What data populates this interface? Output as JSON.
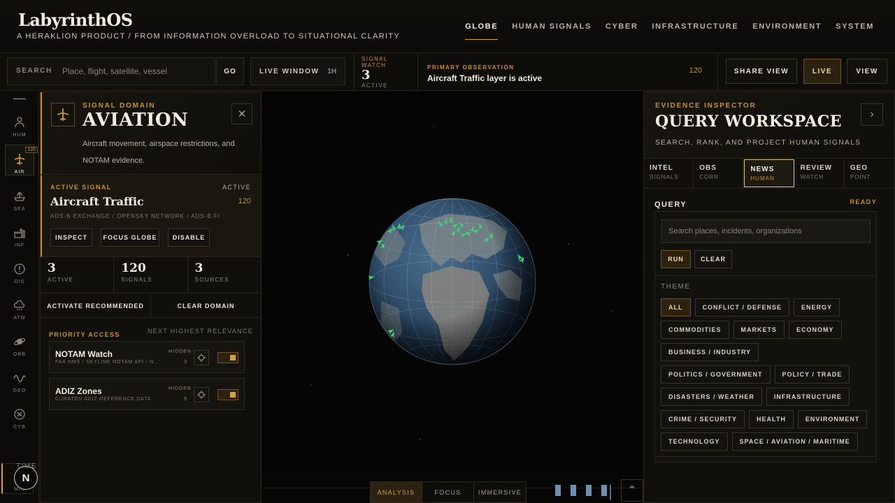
{
  "header": {
    "logo": "LabyrinthOS",
    "tagline": "A HERAKLION PRODUCT / FROM INFORMATION OVERLOAD TO SITUATIONAL CLARITY",
    "nav": [
      "GLOBE",
      "HUMAN SIGNALS",
      "CYBER",
      "INFRASTRUCTURE",
      "ENVIRONMENT",
      "SYSTEM"
    ],
    "active_nav": "GLOBE"
  },
  "toolbar": {
    "search_label": "SEARCH",
    "search_placeholder": "Place, flight, satellite, vessel",
    "go_label": "GO",
    "live_window_label": "LIVE WINDOW",
    "live_window_value": "1H",
    "signal_watch_label": "SIGNAL WATCH",
    "signal_watch_count": "3",
    "signal_watch_sub": "ACTIVE",
    "primary_obs_label": "PRIMARY OBSERVATION",
    "primary_obs_text": "Aircraft Traffic layer is active",
    "primary_obs_count": "120",
    "share_view_label": "SHARE VIEW",
    "live_label": "LIVE",
    "view_label": "VIEW"
  },
  "rail": {
    "items": [
      {
        "label": "HUM",
        "icon": "person-icon"
      },
      {
        "label": "AIR",
        "icon": "plane-icon",
        "badge": "120"
      },
      {
        "label": "SEA",
        "icon": "ship-icon"
      },
      {
        "label": "INF",
        "icon": "factory-icon"
      },
      {
        "label": "DIS",
        "icon": "alert-icon"
      },
      {
        "label": "ATM",
        "icon": "cloud-icon"
      },
      {
        "label": "ORB",
        "icon": "satellite-icon"
      },
      {
        "label": "GEO",
        "icon": "wave-icon"
      },
      {
        "label": "CYB",
        "icon": "cyber-icon"
      }
    ],
    "avatar_letter": "N",
    "min_label": "MIN"
  },
  "domain": {
    "kicker": "SIGNAL DOMAIN",
    "title": "AVIATION",
    "description": "Aircraft movement, airspace restrictions, and NOTAM evidence.",
    "active_signal": {
      "kicker": "ACTIVE SIGNAL",
      "state": "ACTIVE",
      "name": "Aircraft Traffic",
      "count": "120",
      "sources": "ADS-B EXCHANGE / OPENSKY NETWORK / ADS-B.FI",
      "inspect_label": "INSPECT",
      "focus_label": "FOCUS GLOBE",
      "disable_label": "DISABLE"
    },
    "stats": [
      {
        "value": "3",
        "label": "ACTIVE"
      },
      {
        "value": "120",
        "label": "SIGNALS"
      },
      {
        "value": "3",
        "label": "SOURCES"
      }
    ],
    "activate_label": "ACTIVATE RECOMMENDED",
    "clear_label": "CLEAR DOMAIN",
    "priority_label": "PRIORITY ACCESS",
    "priority_sub": "NEXT HIGHEST RELEVANCE",
    "priority_items": [
      {
        "name": "NOTAM Watch",
        "source": "FAA NMS / SKYLINK NOTAM API / N…",
        "state": "HIDDEN",
        "count": "3"
      },
      {
        "name": "ADIZ Zones",
        "source": "CURATED ADIZ REFERENCE DATA",
        "state": "HIDDEN",
        "count": "5"
      }
    ]
  },
  "globe": {
    "ocean_color": "#2c4a66",
    "land_color": "#7d8588",
    "aircraft_color": "#3fd07a"
  },
  "modes": [
    "ANALYSIS",
    "FOCUS",
    "IMMERSIVE"
  ],
  "active_mode": "ANALYSIS",
  "inspector": {
    "kicker": "EVIDENCE INSPECTOR",
    "title": "QUERY WORKSPACE",
    "subtitle": "SEARCH, RANK, AND PROJECT HUMAN SIGNALS",
    "tabs": [
      {
        "title": "INTEL",
        "sub": "SIGNALS"
      },
      {
        "title": "OBS",
        "sub": "CORR"
      },
      {
        "title": "NEWS",
        "sub": "HUMAN"
      },
      {
        "title": "REVIEW",
        "sub": "WATCH"
      },
      {
        "title": "GEO",
        "sub": "POINT"
      }
    ],
    "active_tab": "NEWS",
    "query_label": "QUERY",
    "query_status": "READY",
    "query_placeholder": "Search places, incidents, organizations",
    "run_label": "RUN",
    "clear_label": "CLEAR",
    "theme_label": "THEME",
    "themes": [
      "ALL",
      "CONFLICT / DEFENSE",
      "ENERGY",
      "COMMODITIES",
      "MARKETS",
      "ECONOMY",
      "BUSINESS / INDUSTRY",
      "POLITICS / GOVERNMENT",
      "POLICY / TRADE",
      "DISASTERS / WEATHER",
      "INFRASTRUCTURE",
      "CRIME / SECURITY",
      "HEALTH",
      "ENVIRONMENT",
      "TECHNOLOGY",
      "SPACE / AVIATION / MARITIME"
    ],
    "active_theme": "ALL",
    "time_label": "TIME"
  }
}
